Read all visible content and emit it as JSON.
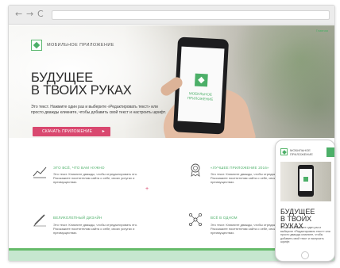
{
  "browser": {
    "nav": [
      "←",
      "→",
      "C"
    ]
  },
  "hero": {
    "top_link": "Главная",
    "logo_text": "МОБИЛЬНОЕ ПРИЛОЖЕНИЕ",
    "title_line1": "БУДУЩЕЕ",
    "title_line2": "В ТВОИХ РУКАХ",
    "body": "Это текст. Нажмите один раз и выберите «Редактировать текст» или просто дважды кликните, чтобы добавить свой текст и настроить шрифт.",
    "cta_label": "СКАЧАТЬ ПРИЛОЖЕНИЕ",
    "cta_arrow": "▸",
    "phone_text_line1": "МОБИЛЬНОЕ",
    "phone_text_line2": "ПРИЛОЖЕНИЕ"
  },
  "features": [
    {
      "title": "ЭТО ВСЁ, ЧТО ВАМ НУЖНО",
      "body": "Это текст. Кликните дважды, чтобы отредактировать его. Расскажите посетителям сайта о себе, своих услугах и преимуществах.",
      "icon": "chart-icon"
    },
    {
      "title": "«ЛУЧШЕЕ ПРИЛОЖЕНИЕ 2016»",
      "body": "Это текст. Кликните дважды, чтобы отредактировать его. Расскажите посетителям сайта о себе, своих услугах и преимуществах.",
      "icon": "award-icon"
    },
    {
      "title": "ВЕЛИКОЛЕПНЫЙ ДИЗАЙН",
      "body": "Это текст. Кликните дважды, чтобы отредактировать его. Расскажите посетителям сайта о себе, своих услугах и преимуществах.",
      "icon": "pencil-icon"
    },
    {
      "title": "ВСЁ В ОДНОМ",
      "body": "Это текст. Кликните дважды, чтобы отредактировать его. Расскажите посетителям сайта о себе, своих услугах и преимуществах.",
      "icon": "network-icon"
    }
  ],
  "plus": "+",
  "mobile": {
    "logo_line1": "МОБИЛЬНОЕ",
    "logo_line2": "ПРИЛОЖЕНИЕ",
    "title_line1": "БУДУЩЕЕ",
    "title_line2": "В ТВОИХ РУКАХ",
    "body": "Это текст. Нажмите один раз и выберите «Редактировать текст» или просто дважды кликните, чтобы добавить свой текст и настроить шрифт."
  },
  "colors": {
    "accent_green": "#4caf68",
    "cta_pink": "#d9486f",
    "bar_green": "#c6e7cf"
  }
}
